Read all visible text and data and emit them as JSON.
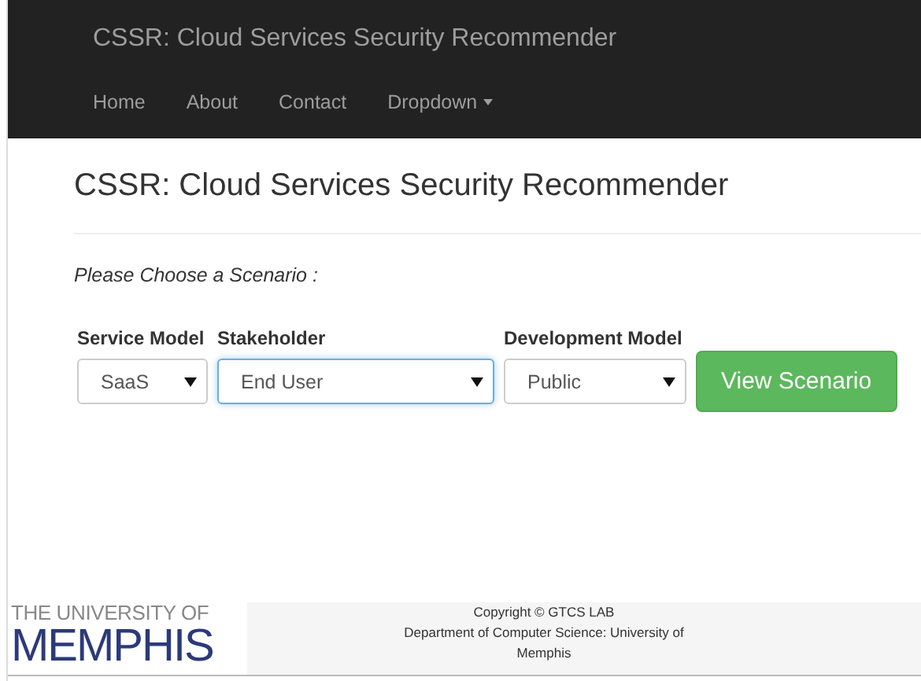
{
  "navbar": {
    "brand": "CSSR: Cloud Services Security Recommender",
    "items": [
      {
        "label": "Home",
        "kind": "link"
      },
      {
        "label": "About",
        "kind": "link"
      },
      {
        "label": "Contact",
        "kind": "link"
      },
      {
        "label": "Dropdown",
        "kind": "dropdown"
      }
    ]
  },
  "heading": "CSSR: Cloud Services Security Recommender",
  "prompt": "Please Choose a Scenario :",
  "form": {
    "fields": [
      {
        "label": "Service Model",
        "value": "SaaS",
        "focused": false
      },
      {
        "label": "Stakeholder",
        "value": "End User",
        "focused": true
      },
      {
        "label": "Development Model",
        "value": "Public",
        "focused": false
      }
    ],
    "button": "View Scenario"
  },
  "footer": {
    "logo": {
      "top": "THE UNIVERSITY OF",
      "bottom": "MEMPHIS"
    },
    "copyright": "Copyright © GTCS LAB",
    "department": "Department of Computer Science: University of Memphis"
  }
}
